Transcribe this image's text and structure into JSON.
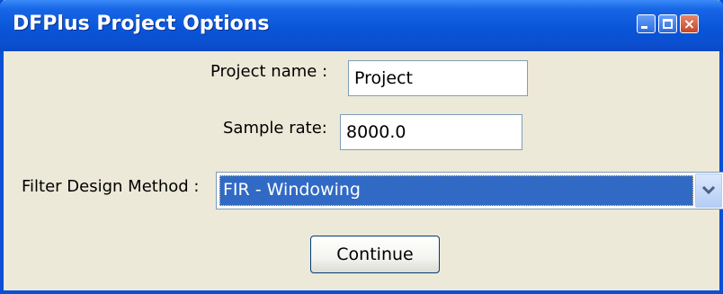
{
  "window": {
    "title": "DFPlus Project Options",
    "controls": {
      "minimize": "minimize-icon",
      "maximize": "maximize-icon",
      "close": "close-icon"
    }
  },
  "form": {
    "project_name_label": "Project name :",
    "project_name_value": "Project",
    "sample_rate_label": "Sample rate:",
    "sample_rate_value": "8000.0",
    "filter_method_label": "Filter Design Method :",
    "filter_method_selected": "FIR - Windowing",
    "continue_label": "Continue"
  },
  "colors": {
    "titlebar": "#0a55d8",
    "window_bg": "#ece9d8",
    "selection": "#316ac5"
  }
}
